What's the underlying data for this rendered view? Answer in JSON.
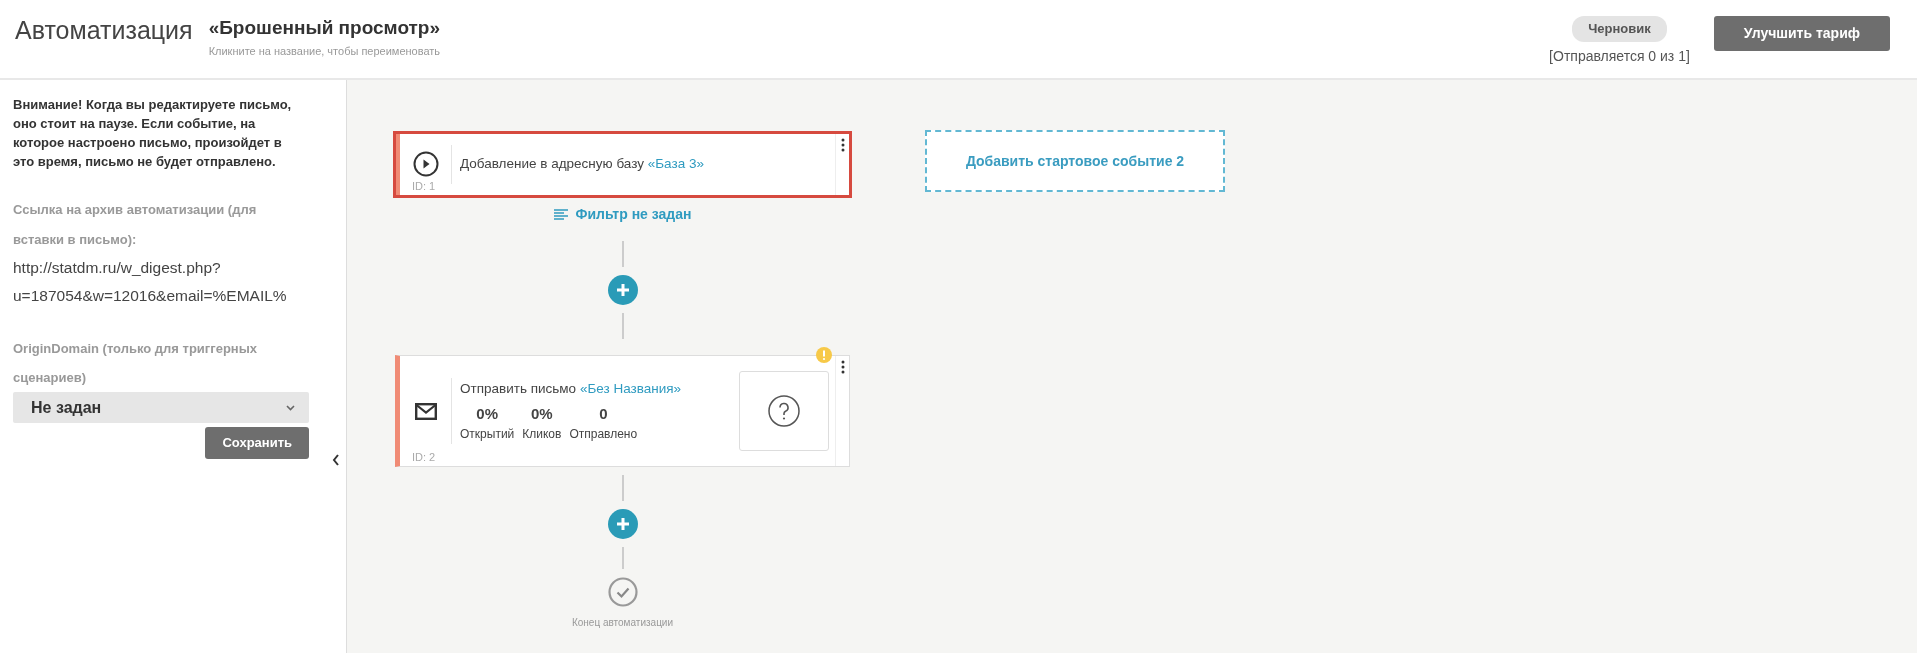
{
  "header": {
    "section_title": "Автоматизация",
    "scenario_name": "«Брошенный просмотр»",
    "rename_hint": "Кликните на название, чтобы переименовать",
    "status_badge": "Черновик",
    "sending_status": "[Отправляется 0 из 1]",
    "upgrade_button": "Улучшить тариф"
  },
  "sidebar": {
    "warning": "Внимание! Когда вы редактируете письмо, оно стоит на паузе. Если событие, на которое настроено письмо, произойдет в это время, письмо не будет отправлено.",
    "archive_label": "Ссылка на архив автоматизации (для вставки в письмо):",
    "archive_url": "http://statdm.ru/w_digest.php?u=187054&w=12016&email=%EMAIL%",
    "origin_label": "OriginDomain (только для триггерных сценариев)",
    "origin_select": "Не задан",
    "save_button": "Сохранить"
  },
  "flow": {
    "steps": [
      {
        "kind": "trigger",
        "selected": true,
        "warning": false,
        "text": "Добавление в адресную базу",
        "link": "«База 3»",
        "id_label": "ID: 1",
        "filter": "Фильтр не задан"
      },
      {
        "kind": "email",
        "selected": false,
        "warning": true,
        "text": "Отправить письмо",
        "link": "«Без Названия»",
        "id_label": "ID: 2",
        "stats": [
          {
            "value": "0%",
            "label": "Открытий"
          },
          {
            "value": "0%",
            "label": "Кликов"
          },
          {
            "value": "0",
            "label": "Отправлено"
          }
        ]
      }
    ],
    "add_start_event": "Добавить стартовое событие 2",
    "end_label": "Конец автоматизации"
  }
}
